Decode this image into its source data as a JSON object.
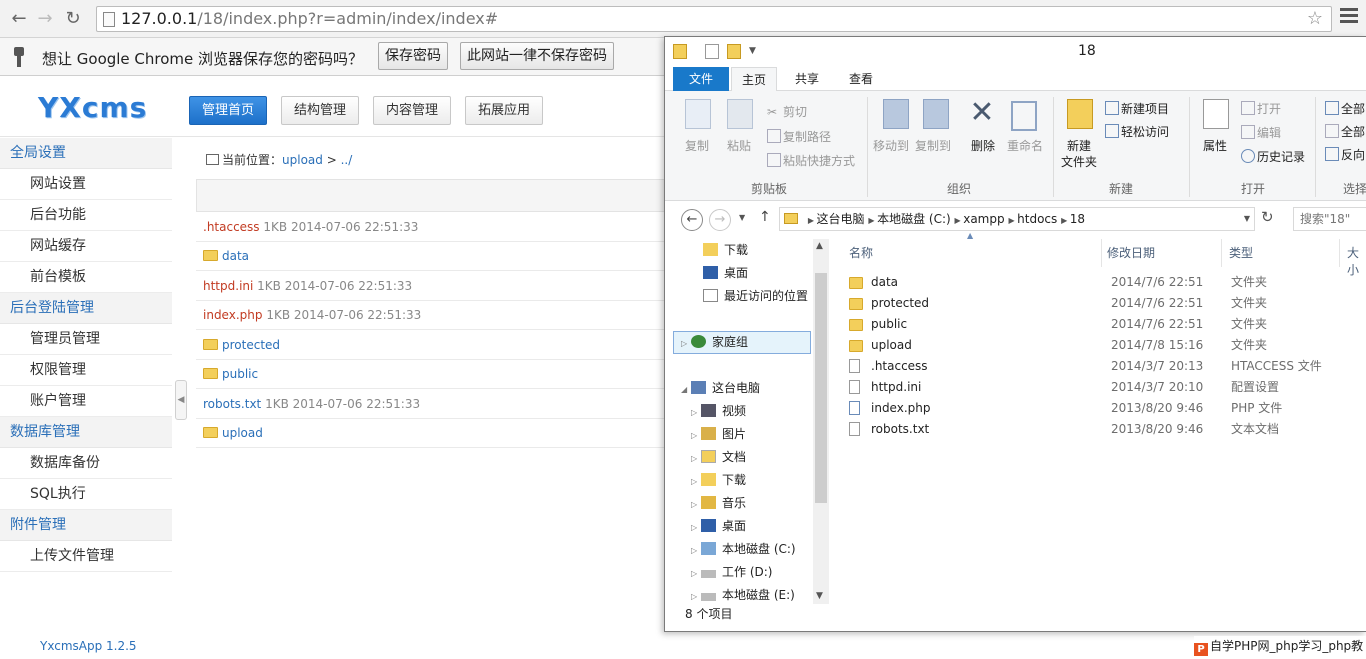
{
  "browser": {
    "url_host": "127.0.0.1",
    "url_path": "/18/index.php?r=admin/index/index#"
  },
  "infobar": {
    "message": "想让 Google Chrome 浏览器保存您的密码吗？",
    "save_label": "保存密码",
    "never_label": "此网站一律不保存密码"
  },
  "cms": {
    "logo": "YXcms",
    "topnav": [
      "管理首页",
      "结构管理",
      "内容管理",
      "拓展应用"
    ],
    "sidebar": [
      {
        "group": "全局设置",
        "items": [
          "网站设置",
          "后台功能",
          "网站缓存",
          "前台模板"
        ]
      },
      {
        "group": "后台登陆管理",
        "items": [
          "管理员管理",
          "权限管理",
          "账户管理"
        ]
      },
      {
        "group": "数据库管理",
        "items": [
          "数据库备份",
          "SQL执行"
        ]
      },
      {
        "group": "附件管理",
        "items": [
          "上传文件管理"
        ]
      }
    ],
    "version": "YxcmsApp 1.2.5",
    "breadcrumb_prefix": "当前位置：",
    "breadcrumb_link": "upload",
    "breadcrumb_sep": ">",
    "breadcrumb_tail": "../",
    "files": [
      {
        "name": ".htaccess",
        "meta": "1KB   2014-07-06 22:51:33",
        "kind": "file"
      },
      {
        "name": "data",
        "meta": "",
        "kind": "folder"
      },
      {
        "name": "httpd.ini",
        "meta": "1KB   2014-07-06 22:51:33",
        "kind": "file"
      },
      {
        "name": "index.php",
        "meta": "1KB   2014-07-06 22:51:33",
        "kind": "file"
      },
      {
        "name": "protected",
        "meta": "",
        "kind": "folder"
      },
      {
        "name": "public",
        "meta": "",
        "kind": "folder"
      },
      {
        "name": "robots.txt",
        "meta": "1KB   2014-07-06 22:51:33",
        "kind": "file-blue"
      },
      {
        "name": "upload",
        "meta": "",
        "kind": "folder"
      }
    ]
  },
  "explorer": {
    "title": "18",
    "tabs": {
      "file": "文件",
      "home": "主页",
      "share": "共享",
      "view": "查看"
    },
    "ribbon": {
      "copy": "复制",
      "paste": "粘贴",
      "cut": "剪切",
      "copy_path": "复制路径",
      "paste_shortcut": "粘贴快捷方式",
      "clipboard": "剪贴板",
      "move_to": "移动到",
      "copy_to": "复制到",
      "delete": "删除",
      "rename": "重命名",
      "organize": "组织",
      "new_item": "新建项目",
      "easy_access": "轻松访问",
      "new_folder_1": "新建",
      "new_folder_2": "文件夹",
      "new": "新建",
      "properties": "属性",
      "open": "打开",
      "edit": "编辑",
      "history": "历史记录",
      "open_group": "打开",
      "select_all": "全部",
      "select_none": "全部",
      "invert": "反向",
      "select_group": "选择"
    },
    "address": [
      "这台电脑",
      "本地磁盘 (C:)",
      "xampp",
      "htdocs",
      "18"
    ],
    "search_placeholder": "搜索\"18\"",
    "nav": {
      "downloads": "下载",
      "desktop": "桌面",
      "recent": "最近访问的位置",
      "homegroup": "家庭组",
      "this_pc": "这台电脑",
      "videos": "视频",
      "pictures": "图片",
      "documents": "文档",
      "downloads2": "下载",
      "music": "音乐",
      "desktop2": "桌面",
      "local_c": "本地磁盘 (C:)",
      "work_d": "工作 (D:)",
      "local_e": "本地磁盘 (E:)"
    },
    "columns": {
      "name": "名称",
      "date": "修改日期",
      "type": "类型",
      "size": "大小"
    },
    "rows": [
      {
        "name": "data",
        "date": "2014/7/6 22:51",
        "type": "文件夹",
        "kind": "folder"
      },
      {
        "name": "protected",
        "date": "2014/7/6 22:51",
        "type": "文件夹",
        "kind": "folder"
      },
      {
        "name": "public",
        "date": "2014/7/6 22:51",
        "type": "文件夹",
        "kind": "folder"
      },
      {
        "name": "upload",
        "date": "2014/7/8 15:16",
        "type": "文件夹",
        "kind": "folder"
      },
      {
        "name": ".htaccess",
        "date": "2014/3/7 20:13",
        "type": "HTACCESS 文件",
        "kind": "doc"
      },
      {
        "name": "httpd.ini",
        "date": "2014/3/7 20:10",
        "type": "配置设置",
        "kind": "doc"
      },
      {
        "name": "index.php",
        "date": "2013/8/20 9:46",
        "type": "PHP 文件",
        "kind": "doc"
      },
      {
        "name": "robots.txt",
        "date": "2013/8/20 9:46",
        "type": "文本文档",
        "kind": "doc"
      }
    ],
    "status": "8 个项目"
  },
  "watermark": {
    "text": "自学PHP网_php学习_php教"
  },
  "colors": {
    "accent": "#1d70c9",
    "link": "#2a6fb8",
    "file_red": "#c23b22",
    "ribbon_file_tab": "#1979ca"
  }
}
